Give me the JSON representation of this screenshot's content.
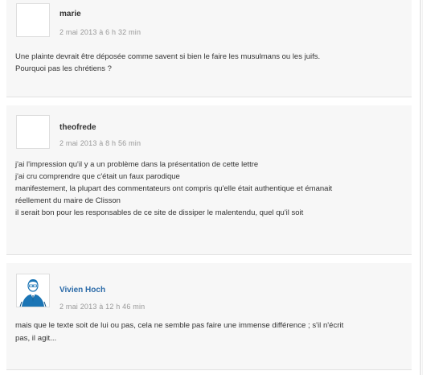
{
  "comments": [
    {
      "author": "marie",
      "date": "2 mai 2013 à 6 h 32 min",
      "lines": [
        "Une plainte devrait être déposée comme savent si bien le faire les musulmans ou les juifs.",
        "Pourquoi pas les chrétiens ?"
      ]
    },
    {
      "author": "theofrede",
      "date": "2 mai 2013 à 8 h 56 min",
      "lines": [
        "j'ai l'impression qu'il y a un problème dans la présentation de cette lettre",
        "j'ai cru comprendre que c'était un faux parodique",
        "manifestement, la plupart des commentateurs ont compris qu'elle était authentique et émanait",
        "réellement du maire de Clisson",
        "il serait bon pour les responsables de ce site de dissiper le malentendu, quel qu'il soit"
      ]
    },
    {
      "author": "Vivien Hoch",
      "date": "2 mai 2013 à 12 h 46 min",
      "lines": [
        "mais que le texte soit de lui ou pas, cela ne semble pas faire une immense différence ; s'il n'écrit",
        "pas, il agit..."
      ],
      "avatar": "author-photo"
    }
  ],
  "colors": {
    "comment_bg": "#f7f7f7",
    "author_link": "#2a6aa8",
    "date": "#999999",
    "text": "#333333"
  }
}
